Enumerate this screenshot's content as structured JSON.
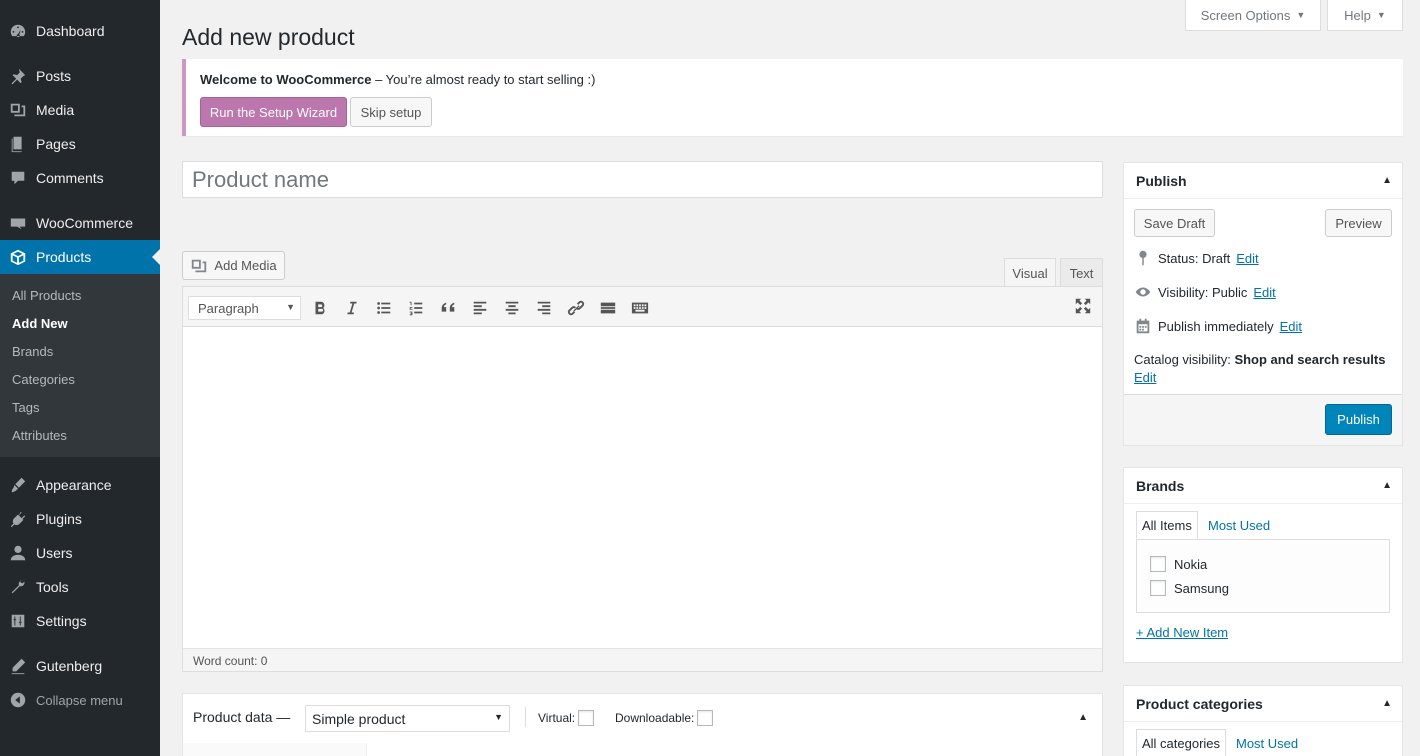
{
  "sidebar": {
    "items": [
      {
        "label": "Dashboard",
        "icon": "dashboard-icon"
      },
      {
        "label": "Posts",
        "icon": "pin-icon"
      },
      {
        "label": "Media",
        "icon": "media-icon"
      },
      {
        "label": "Pages",
        "icon": "pages-icon"
      },
      {
        "label": "Comments",
        "icon": "comments-icon"
      },
      {
        "label": "WooCommerce",
        "icon": "woo-icon"
      },
      {
        "label": "Products",
        "icon": "box-icon"
      },
      {
        "label": "Appearance",
        "icon": "brush-icon"
      },
      {
        "label": "Plugins",
        "icon": "plug-icon"
      },
      {
        "label": "Users",
        "icon": "users-icon"
      },
      {
        "label": "Tools",
        "icon": "wrench-icon"
      },
      {
        "label": "Settings",
        "icon": "settings-icon"
      },
      {
        "label": "Gutenberg",
        "icon": "gutenberg-icon"
      }
    ],
    "submenu": [
      "All Products",
      "Add New",
      "Brands",
      "Categories",
      "Tags",
      "Attributes"
    ],
    "collapse_label": "Collapse menu"
  },
  "top": {
    "screen_options": "Screen Options",
    "help": "Help"
  },
  "page_title": "Add new product",
  "notice": {
    "bold": "Welcome to WooCommerce",
    "rest": " – You’re almost ready to start selling :)",
    "wizard_button": "Run the Setup Wizard",
    "skip_button": "Skip setup"
  },
  "title_input": {
    "placeholder": "Product name",
    "value": ""
  },
  "editor": {
    "add_media": "Add Media",
    "tab_visual": "Visual",
    "tab_text": "Text",
    "format": "Paragraph",
    "word_count": "Word count: 0"
  },
  "product_data": {
    "title": "Product data —",
    "type": "Simple product",
    "virtual": "Virtual:",
    "downloadable": "Downloadable:"
  },
  "publish": {
    "title": "Publish",
    "save_draft": "Save Draft",
    "preview": "Preview",
    "status_label": "Status: ",
    "status_value": "Draft",
    "visibility_label": "Visibility: ",
    "visibility_value": "Public",
    "publish_label": "Publish ",
    "publish_value": "immediately",
    "catalog_label": "Catalog visibility: ",
    "catalog_value": "Shop and search results",
    "edit": "Edit",
    "publish_button": "Publish"
  },
  "brands": {
    "title": "Brands",
    "tab_all": "All Items",
    "tab_used": "Most Used",
    "items": [
      "Nokia",
      "Samsung"
    ],
    "add_new": "+ Add New Item"
  },
  "categories": {
    "title": "Product categories",
    "tab_all": "All categories",
    "tab_used": "Most Used"
  },
  "colors": {
    "sidebar_bg": "#23282d",
    "active_blue": "#0073aa",
    "woo_purple": "#bb77ae",
    "publish_blue": "#0085ba"
  }
}
